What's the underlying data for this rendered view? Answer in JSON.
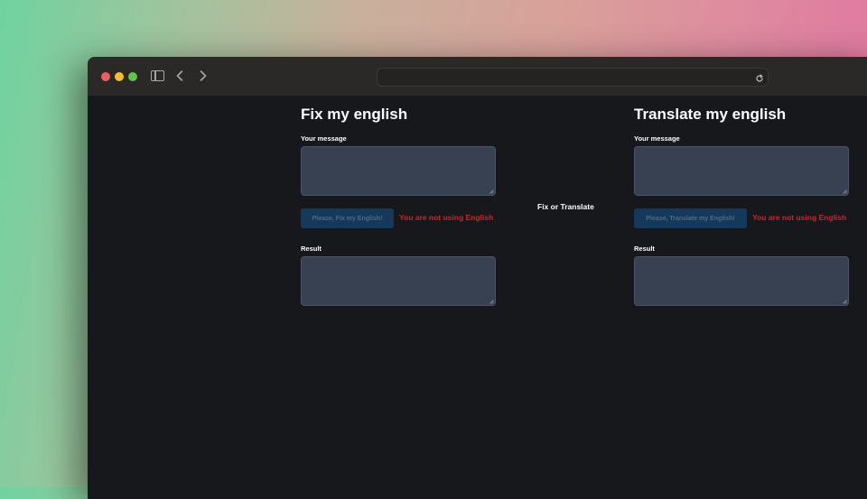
{
  "browser": {
    "address": ""
  },
  "fix_panel": {
    "title": "Fix my english",
    "message_label": "Your message",
    "message_value": "",
    "button_label": "Please, Fix my English!",
    "error_text": "You are not using English",
    "result_label": "Result",
    "result_value": ""
  },
  "center": {
    "toggle_label": "Fix or Translate"
  },
  "translate_panel": {
    "title": "Translate my english",
    "message_label": "Your message",
    "message_value": "",
    "button_label": "Please, Translate my English!",
    "error_text": "You are not using English",
    "result_label": "Result",
    "result_value": ""
  },
  "colors": {
    "background": "#16181c",
    "textarea": "#374151",
    "button": "#15395a",
    "error": "#c7272e",
    "traffic_red": "#ee5f57",
    "traffic_yellow": "#f6bd31",
    "traffic_green": "#5fc648"
  },
  "icons": {
    "sidebar": "sidebar-icon",
    "back": "chevron-left-icon",
    "forward": "chevron-right-icon",
    "reload": "reload-icon"
  }
}
